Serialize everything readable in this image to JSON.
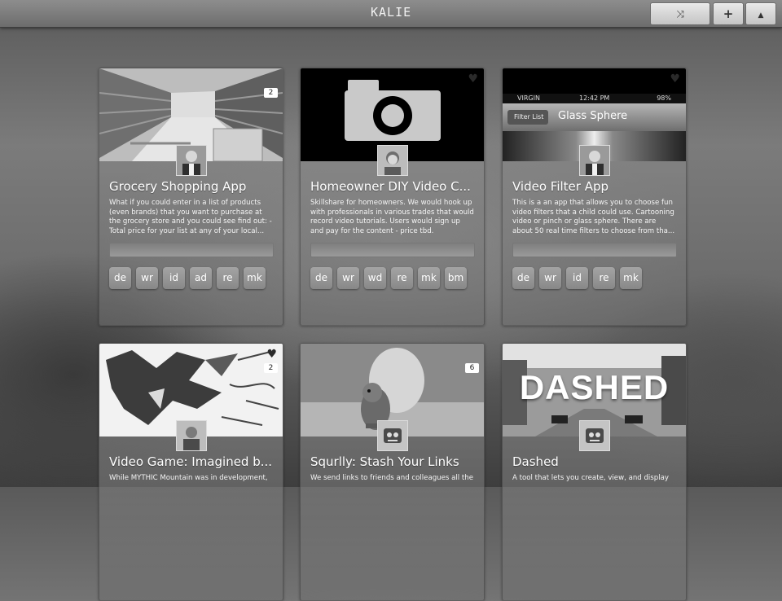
{
  "app": {
    "logo": "KALIE"
  },
  "toolbar": {
    "shuffle_icon": "⤨",
    "add_icon": "+",
    "user_icon": "▲"
  },
  "cards": [
    {
      "title": "Grocery Shopping App",
      "description": "What if you could enter in a list of products (even brands) that you want to purchase at the grocery store and you could see find out: - Total price for your list at any of your local...",
      "tags": [
        "de",
        "wr",
        "id",
        "ad",
        "re",
        "mk"
      ],
      "comment_count": "2",
      "image": "grocery-aisle"
    },
    {
      "title": "Homeowner DIY Video C...",
      "description": "Skillshare for homeowners. We would hook up with professionals in various trades that would record video tutorials. Users would sign up and pay for the content - price tbd.",
      "tags": [
        "de",
        "wr",
        "wd",
        "re",
        "mk",
        "bm"
      ],
      "image": "camera"
    },
    {
      "title": "Video Filter App",
      "description": "This is a an app that allows you to choose fun video filters that a child could use. Cartooning video or pinch or glass sphere. There are about 50 real time filters to choose from tha...",
      "tags": [
        "de",
        "wr",
        "id",
        "re",
        "mk"
      ],
      "image": "phone-screenshot",
      "phone": {
        "carrier": "VIRGIN",
        "time": "12:42 PM",
        "battery": "98%",
        "back": "Filter List",
        "screen_title": "Glass Sphere"
      }
    },
    {
      "title": "Video Game: Imagined b...",
      "description": "While MYTHIC Mountain was in development,",
      "comment_count": "2",
      "image": "dragon-sketch"
    },
    {
      "title": "Squrlly: Stash Your Links",
      "description": "We send links to friends and colleagues all the",
      "comment_count": "6",
      "image": "squirrel"
    },
    {
      "title": "Dashed",
      "description": "A tool that lets you create, view, and display",
      "image": "street",
      "image_text": "DASHED"
    }
  ]
}
